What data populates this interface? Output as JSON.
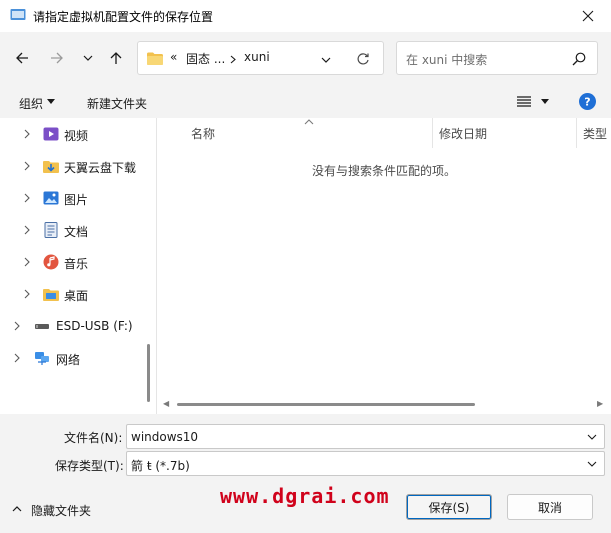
{
  "window": {
    "title": "请指定虚拟机配置文件的保存位置"
  },
  "address": {
    "overflow": "«",
    "crumbs": [
      "固态 ...",
      "xuni"
    ]
  },
  "search": {
    "placeholder": "在 xuni 中搜索"
  },
  "toolbar": {
    "organize_label": "组织",
    "new_folder_label": "新建文件夹"
  },
  "tree": {
    "items": [
      {
        "label": "视频",
        "icon": "video-folder-icon"
      },
      {
        "label": "天翼云盘下载",
        "icon": "download-folder-icon"
      },
      {
        "label": "图片",
        "icon": "pictures-folder-icon"
      },
      {
        "label": "文档",
        "icon": "documents-folder-icon"
      },
      {
        "label": "音乐",
        "icon": "music-folder-icon"
      },
      {
        "label": "桌面",
        "icon": "desktop-folder-icon"
      },
      {
        "label": "ESD-USB (F:)",
        "icon": "usb-drive-icon"
      },
      {
        "label": "网络",
        "icon": "network-icon"
      }
    ]
  },
  "filepane": {
    "columns": [
      "名称",
      "修改日期",
      "类型"
    ],
    "empty_message": "没有与搜索条件匹配的项。"
  },
  "form": {
    "filename_label": "文件名(N):",
    "filename_value": "windows10",
    "filetype_label": "保存类型(T):",
    "filetype_value": "箭    ŧ (*.7b)"
  },
  "bottom": {
    "hide_folders_label": "隐藏文件夹",
    "watermark": "www.dgrai.com",
    "save_label": "保存(S)",
    "cancel_label": "取消"
  },
  "colors": {
    "accent": "#0067c0",
    "watermark": "#d0021b",
    "help": "#1f6fd6"
  }
}
